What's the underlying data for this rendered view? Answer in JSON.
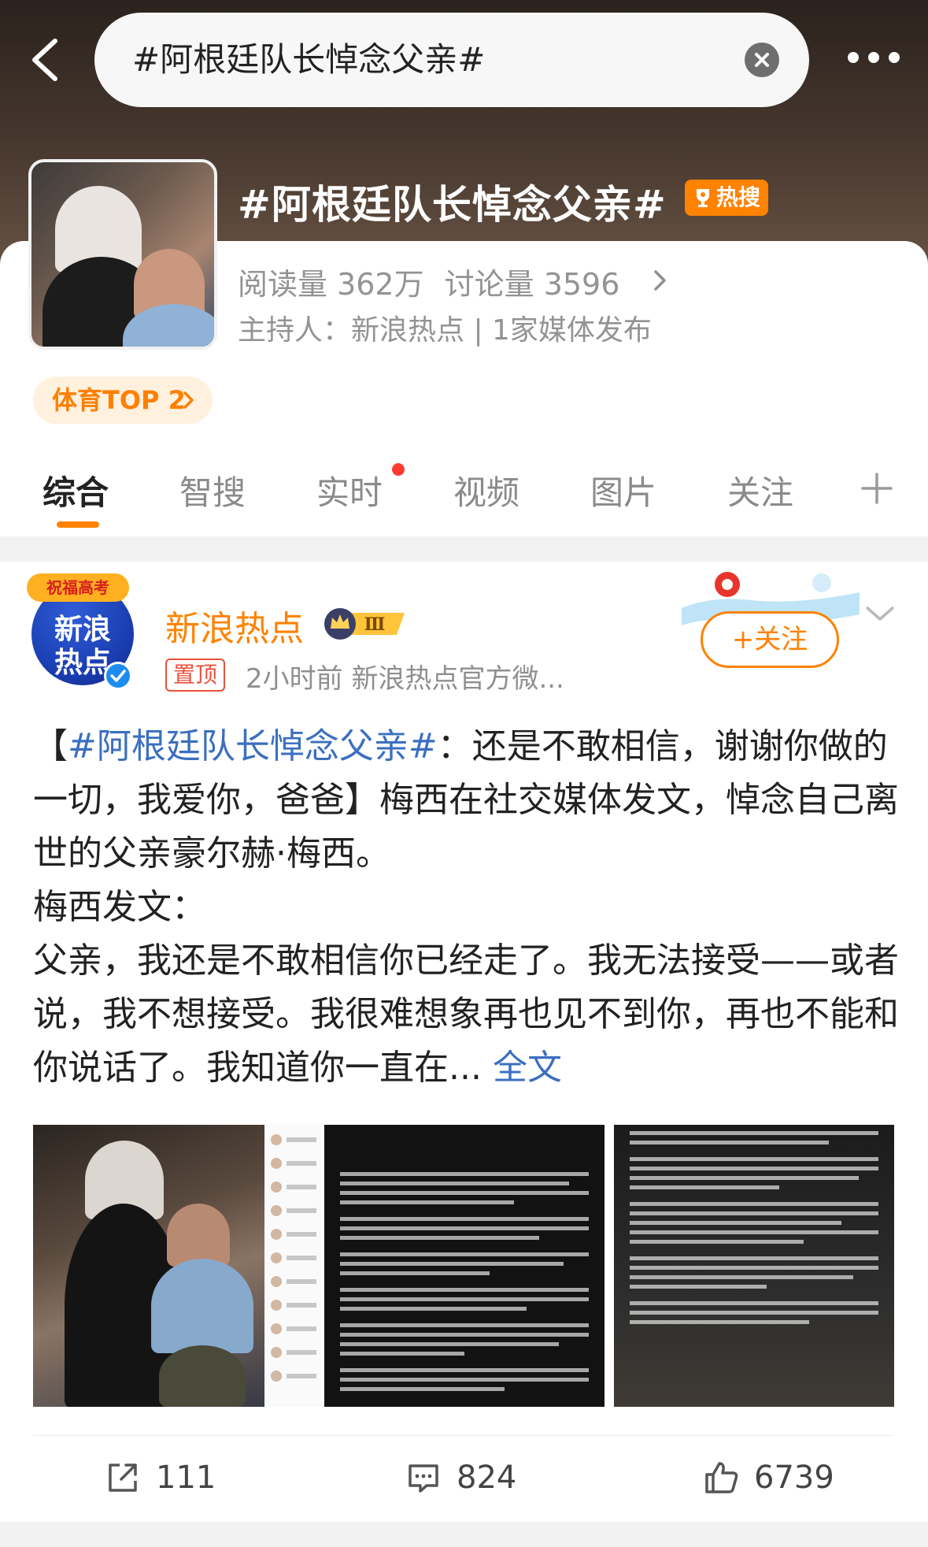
{
  "search": {
    "query": "#阿根廷队长悼念父亲#"
  },
  "topic": {
    "title": "#阿根廷队长悼念父亲#",
    "hot_badge": "热搜",
    "stats": {
      "reads": "阅读量 362万",
      "discussions": "讨论量 3596"
    },
    "host_line": "主持人：新浪热点 | 1家媒体发布",
    "rank_badge": "体育TOP 2"
  },
  "tabs": [
    {
      "label": "综合",
      "active": true
    },
    {
      "label": "智搜"
    },
    {
      "label": "实时",
      "has_dot": true
    },
    {
      "label": "视频"
    },
    {
      "label": "图片"
    },
    {
      "label": "关注"
    }
  ],
  "post": {
    "author": "新浪热点",
    "avatar_text": [
      "新浪",
      "热点"
    ],
    "avatar_ribbon": "祝福高考",
    "level_badge": "Ⅲ",
    "pin_tag": "置顶",
    "meta": "2小时前  新浪热点官方微...",
    "follow_label": "+关注",
    "text": {
      "bracket_open": "【",
      "hashtag": "#阿根廷队长悼念父亲#",
      "headline_rest": "：还是不敢相信，谢谢你做的一切，我爱你，爸爸】梅西在社交媒体发文，悼念自己离世的父亲豪尔赫·梅西。",
      "line_quote_intro": "梅西发文：",
      "body": "父亲，我还是不敢相信你已经走了。我无法接受——或者说，我不想接受。我很难想象再也见不到你，再也不能和你说话了。我知道你一直在...",
      "full_text_link": "全文"
    },
    "actions": {
      "reposts": "111",
      "comments": "824",
      "likes": "6739"
    }
  },
  "colors": {
    "accent": "#ff8200",
    "link": "#3b6fbf",
    "hot": "#ff8200",
    "pin": "#e8513c"
  },
  "icons": [
    "back-arrow-icon",
    "clear-icon",
    "more-icon",
    "chevron-right-icon",
    "plus-icon",
    "chevron-down-icon",
    "share-icon",
    "comment-icon",
    "like-icon",
    "verified-icon",
    "trophy-icon",
    "crown-icon"
  ]
}
